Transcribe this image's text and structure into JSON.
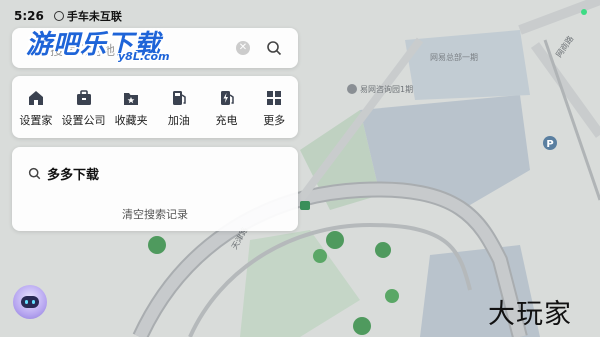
{
  "status_bar": {
    "time": "5:26",
    "network_label": "手车未互联"
  },
  "watermark": {
    "brand": "游吧乐下载",
    "domain": "y8L.com",
    "corner_brand": "大玩家"
  },
  "search": {
    "placeholder": "搜索目的地"
  },
  "quick_actions": [
    {
      "label": "设置家",
      "icon": "home-icon"
    },
    {
      "label": "设置公司",
      "icon": "briefcase-icon"
    },
    {
      "label": "收藏夹",
      "icon": "star-folder-icon"
    },
    {
      "label": "加油",
      "icon": "gas-station-icon"
    },
    {
      "label": "充电",
      "icon": "charging-icon"
    },
    {
      "label": "更多",
      "icon": "grid-icon"
    }
  ],
  "history": {
    "item": "多多下载",
    "clear_label": "清空搜索记录"
  },
  "map_labels": {
    "poi_name": "易网咨询园1期",
    "area_name": "网易总部一期",
    "road_name": "天津路",
    "road_name_2": "网商路"
  },
  "colors": {
    "accent": "#1e64d8",
    "map_bg": "#d9dcda",
    "water": "#b9c3cc",
    "green": "#bfd1c1"
  }
}
